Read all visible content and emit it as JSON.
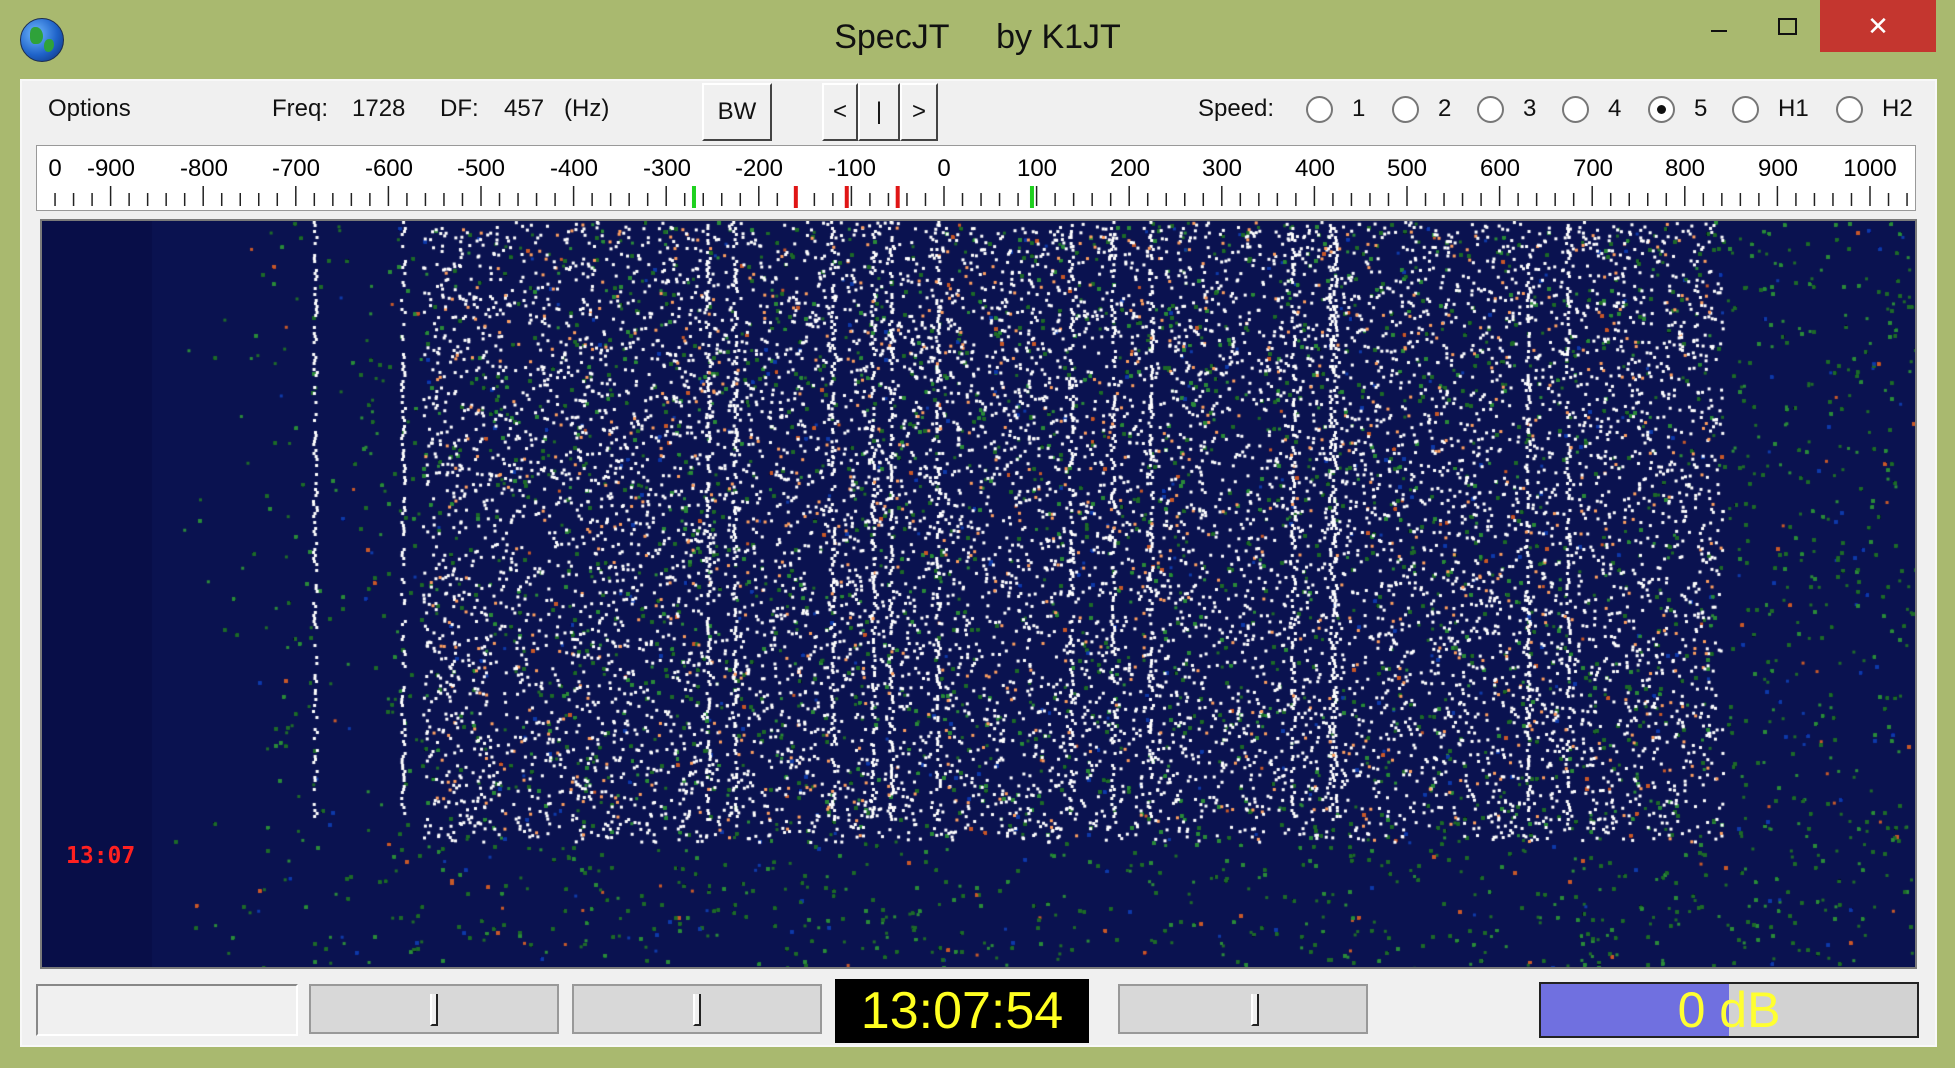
{
  "window": {
    "title": "SpecJT     by K1JT",
    "minimize_icon": "minimize-icon",
    "maximize_icon": "maximize-icon",
    "close_label": "✕"
  },
  "toolbar": {
    "options_label": "Options",
    "freq_label": "Freq:",
    "freq_value": "1728",
    "df_label": "DF:",
    "df_value": "457",
    "df_unit": "(Hz)",
    "bw_label": "BW",
    "left_label": "<",
    "center_label": "|",
    "right_label": ">",
    "speed_label": "Speed:",
    "speed_options": [
      "1",
      "2",
      "3",
      "4",
      "5",
      "H1",
      "H2"
    ],
    "speed_selected": "5"
  },
  "scale": {
    "tick_labels": [
      "0",
      "-900",
      "-800",
      "-700",
      "-600",
      "-500",
      "-400",
      "-300",
      "-200",
      "-100",
      "0",
      "100",
      "200",
      "300",
      "400",
      "500",
      "600",
      "700",
      "800",
      "900",
      "1000"
    ],
    "markers_green": [
      -270,
      95
    ],
    "markers_red": [
      -160,
      -105,
      -50
    ]
  },
  "waterfall": {
    "timestamp": "13:07",
    "colors": {
      "background": "#0a1250",
      "noise": "#1e6d2a",
      "signal": "#ffffff",
      "hot": "#ff7a30"
    }
  },
  "bottom": {
    "clock": "13:07:54",
    "level_text": "0 dB",
    "level_fraction": 0.5,
    "slider_positions": [
      0.5,
      0.5,
      0.55
    ]
  }
}
